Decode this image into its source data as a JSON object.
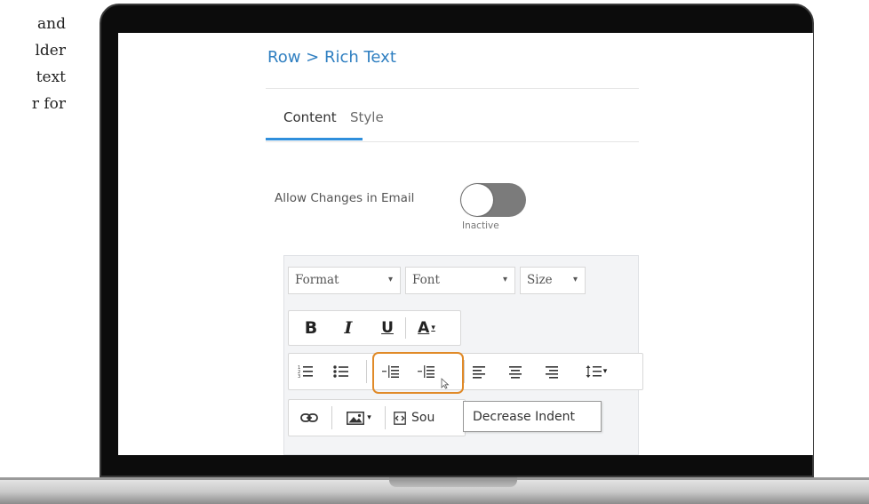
{
  "side_text": [
    "and",
    "lder",
    "text",
    "r  for"
  ],
  "breadcrumb": "Row > Rich Text",
  "tabs": [
    {
      "label": "Content",
      "active": true
    },
    {
      "label": "Style",
      "active": false
    }
  ],
  "allow_changes": {
    "label": "Allow Changes in Email",
    "state": "Inactive"
  },
  "toolbar": {
    "format": {
      "label": "Format",
      "caret": "▾"
    },
    "font": {
      "label": "Font",
      "caret": "▾"
    },
    "size": {
      "label": "Size",
      "caret": "▾"
    },
    "bold": "B",
    "italic": "I",
    "underline": "U",
    "text_color": "A",
    "text_color_caret": "▾",
    "line_height_caret": "▾",
    "image_caret": "▾",
    "source_label": "Sou"
  },
  "tooltip": "Decrease Indent",
  "colors": {
    "accent": "#2f8fdc",
    "link": "#2f7fc1",
    "highlight": "#e08a28",
    "toggle_off": "#7b7b7b"
  }
}
